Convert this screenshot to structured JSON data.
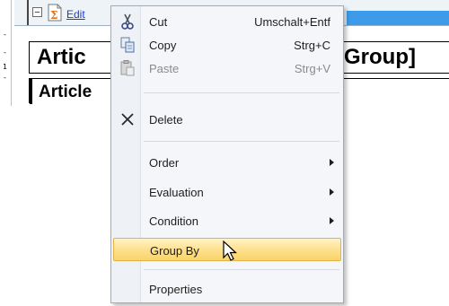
{
  "designer": {
    "ruler_marks": [
      "-",
      "-",
      "1",
      "-"
    ],
    "collapse_symbol": "−",
    "edit_link": "Edit",
    "title_left": "Artic",
    "title_right": "Group]",
    "article_text": "Article"
  },
  "context_menu": {
    "items": [
      {
        "label": "Cut",
        "shortcut": "Umschalt+Entf",
        "icon": "scissors-icon",
        "enabled": true
      },
      {
        "label": "Copy",
        "shortcut": "Strg+C",
        "icon": "copy-icon",
        "enabled": true
      },
      {
        "label": "Paste",
        "shortcut": "Strg+V",
        "icon": "paste-icon",
        "enabled": false
      },
      {
        "label": "Delete",
        "shortcut": "",
        "icon": "delete-x-icon",
        "enabled": true
      },
      {
        "label": "Order",
        "submenu": true
      },
      {
        "label": "Evaluation",
        "submenu": true
      },
      {
        "label": "Condition",
        "submenu": true
      },
      {
        "label": "Group By",
        "highlighted": true
      },
      {
        "label": "Properties"
      }
    ]
  },
  "colors": {
    "header_band": "#3d9be9",
    "highlight_top": "#fff3c8",
    "highlight_bottom": "#fbd36a",
    "highlight_border": "#e2b447"
  }
}
